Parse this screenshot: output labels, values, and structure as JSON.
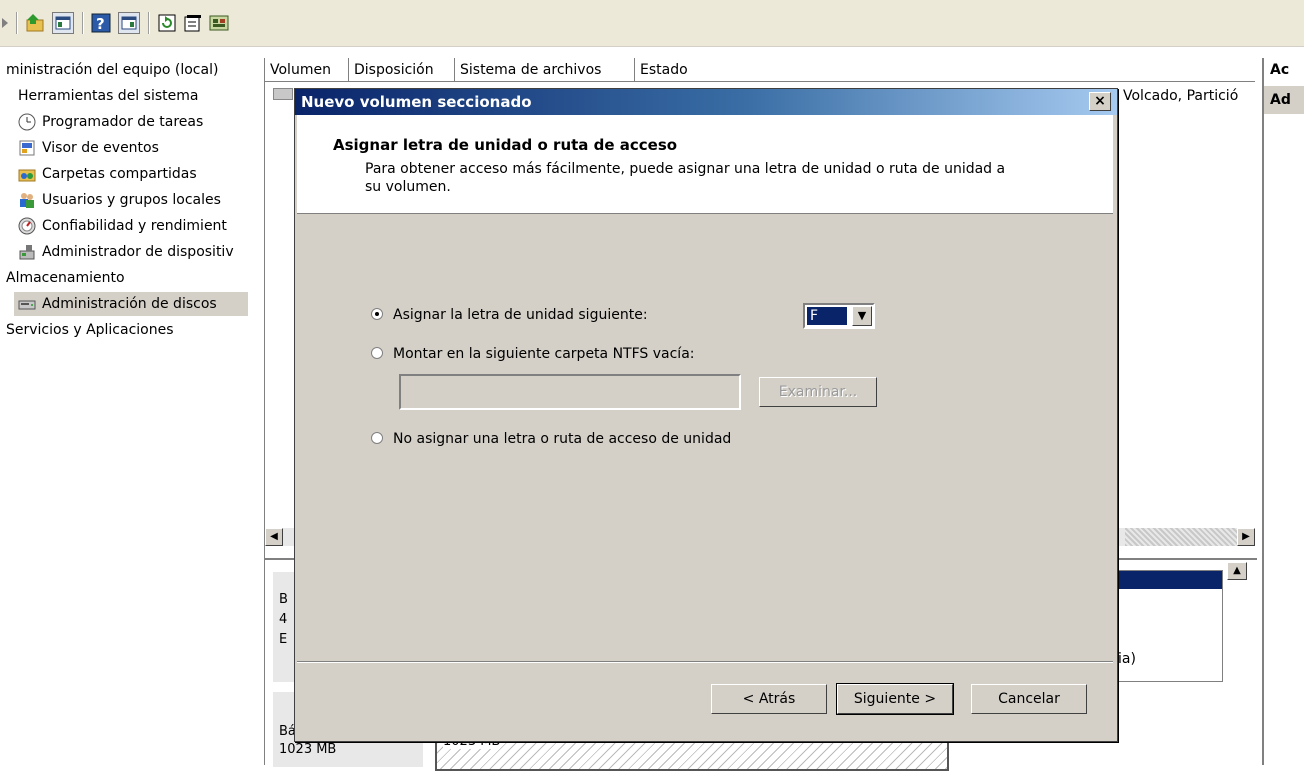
{
  "tree": {
    "root": "ministración del equipo (local)",
    "items": [
      {
        "label": "Herramientas del sistema",
        "icon": "none"
      },
      {
        "label": "Programador de tareas",
        "icon": "clock-icon"
      },
      {
        "label": "Visor de eventos",
        "icon": "event-viewer-icon"
      },
      {
        "label": "Carpetas compartidas",
        "icon": "shared-folder-icon"
      },
      {
        "label": "Usuarios y grupos locales",
        "icon": "users-icon"
      },
      {
        "label": "Confiabilidad y rendimient",
        "icon": "performance-icon"
      },
      {
        "label": "Administrador de dispositiv",
        "icon": "device-manager-icon"
      },
      {
        "label": "Almacenamiento",
        "icon": "none"
      },
      {
        "label": "Administración de discos",
        "icon": "disk-icon"
      },
      {
        "label": "Servicios y Aplicaciones",
        "icon": "none"
      }
    ]
  },
  "list": {
    "columns": [
      "Volumen",
      "Disposición",
      "Sistema de archivos",
      "Estado"
    ],
    "row_status": "Volcado, Partició",
    "graph_label_1": "B",
    "graph_label_2": "4",
    "graph_label_3": "E",
    "graph_basic": "Básico",
    "graph_size": "1023 MB",
    "graph_size2": "1023 MB",
    "graph_fragment": "ia)"
  },
  "actions": {
    "header": "Ac",
    "item": "Ad"
  },
  "dialog": {
    "title": "Nuevo volumen seccionado",
    "close_glyph": "×",
    "header_title": "Asignar letra de unidad o ruta de acceso",
    "header_desc": "Para obtener acceso más fácilmente, puede asignar una letra de unidad o ruta de unidad a su volumen.",
    "opt_assign": "Asignar la letra de unidad siguiente:",
    "opt_mount": "Montar en la siguiente carpeta NTFS vacía:",
    "opt_none": "No asignar una letra o ruta de acceso de unidad",
    "drive_letter": "F",
    "browse": "Examinar...",
    "back": "< Atrás",
    "next": "Siguiente >",
    "cancel": "Cancelar"
  }
}
